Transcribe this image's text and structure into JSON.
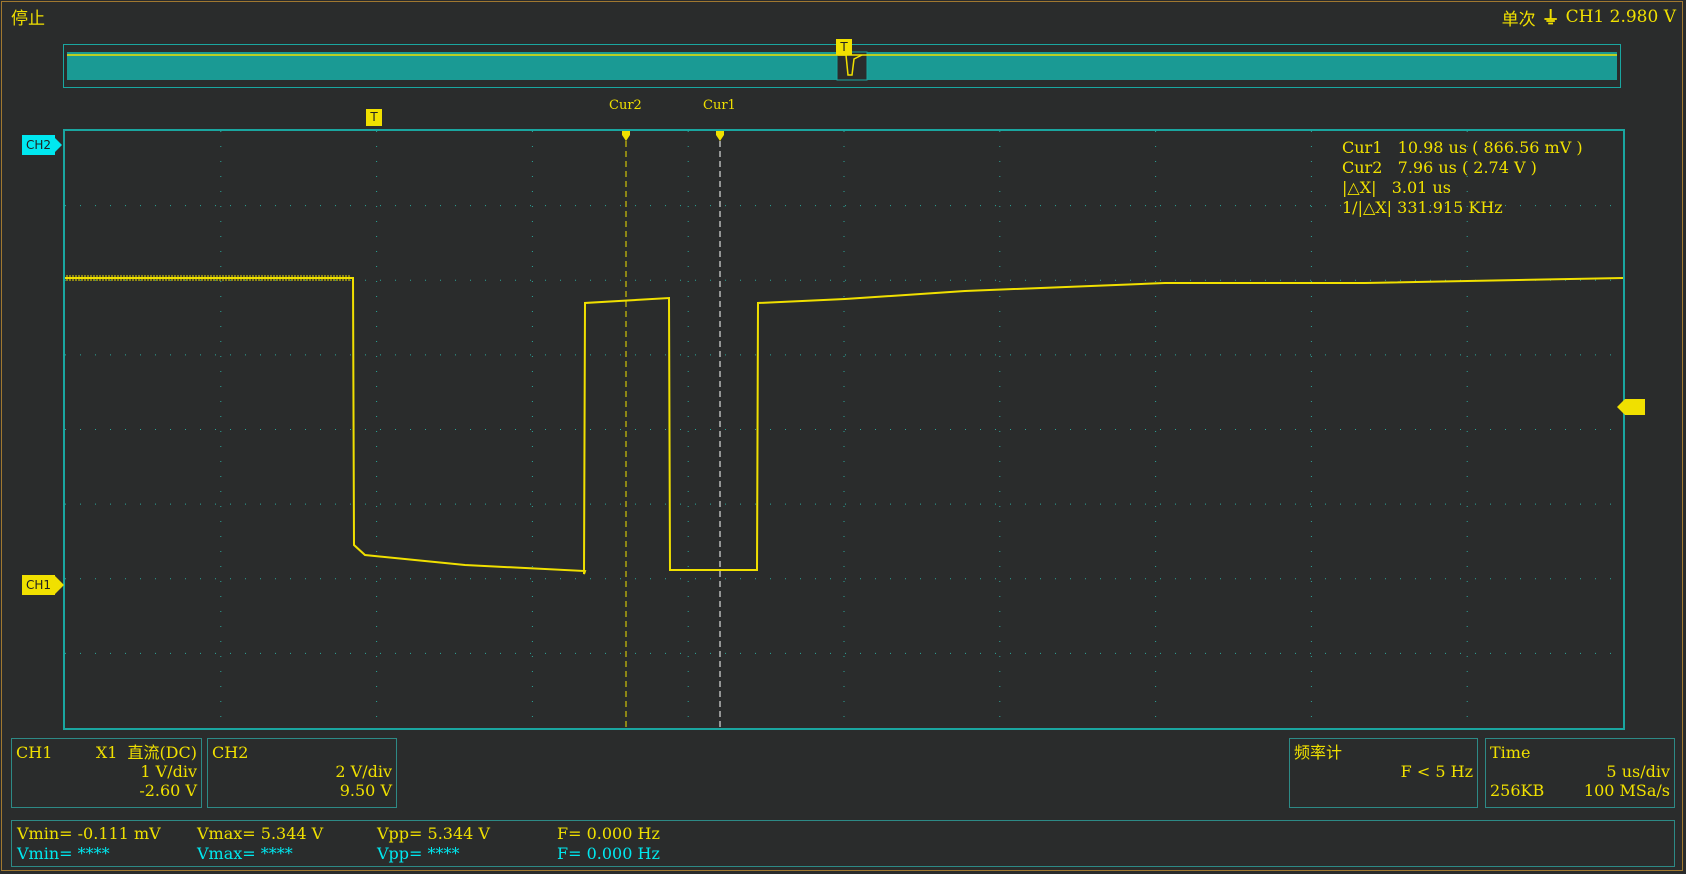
{
  "status": {
    "run_state": "停止",
    "trigger_mode": "单次",
    "trigger_icon": "trigger-edge-icon",
    "trigger_glyph": "⏚",
    "trigger_level": "CH1 2.980 V"
  },
  "markers": {
    "trigger": "T",
    "cur2": "Cur2",
    "cur1": "Cur1",
    "ch2": "CH2",
    "ch1": "CH1"
  },
  "cursor_readout": {
    "cur1": "Cur1   10.98 us ( 866.56 mV )",
    "cur2": "Cur2   7.96 us ( 2.74 V )",
    "dx": "|△X|   3.01 us",
    "inv_dx": "1/|△X| 331.915 KHz"
  },
  "ch1_panel": {
    "name": "CH1",
    "probe": "X1",
    "coupling": "直流(DC)",
    "scale": "1 V/div",
    "offset": "-2.60 V"
  },
  "ch2_panel": {
    "name": "CH2",
    "scale": "2 V/div",
    "offset": "9.50 V"
  },
  "freq_panel": {
    "title": "频率计",
    "value": "F < 5 Hz"
  },
  "time_panel": {
    "title": "Time",
    "scale": "5 us/div",
    "memory": "256KB",
    "sample_rate": "100 MSa/s"
  },
  "measurements": {
    "ch1": {
      "vmin": "Vmin= -0.111 mV",
      "vmax": "Vmax= 5.344 V",
      "vpp": "Vpp= 5.344 V",
      "f": "F= 0.000 Hz"
    },
    "ch2": {
      "vmin": "Vmin= ****",
      "vmax": "Vmax= ****",
      "vpp": "Vpp= ****",
      "f": "F= 0.000 Hz"
    }
  },
  "colors": {
    "ch1": "#f0e000",
    "ch2": "#00e8f0",
    "grid_border": "#1aa6a0",
    "background": "#2a2c2c"
  }
}
